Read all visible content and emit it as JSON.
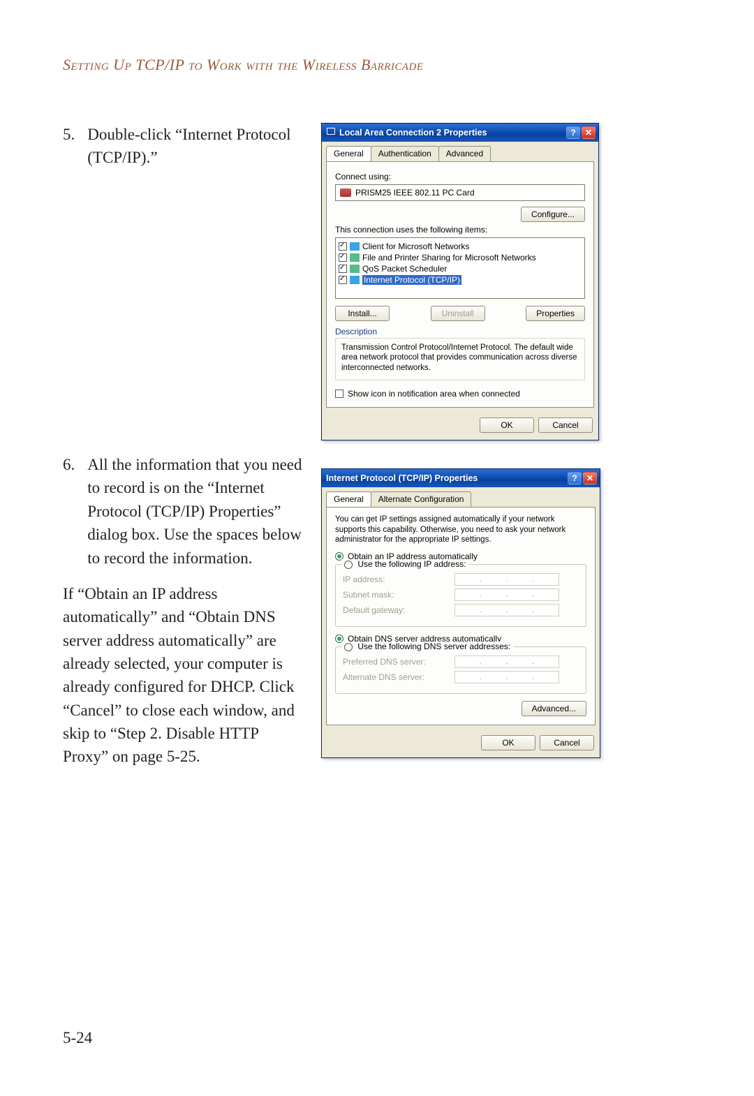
{
  "running_head": "Setting Up TCP/IP to Work with the Wireless Barricade",
  "page_number": "5-24",
  "steps": {
    "s5": {
      "num": "5.",
      "text": "Double-click “Internet Protocol (TCP/IP).”"
    },
    "s6": {
      "num": "6.",
      "text": "All the information that you need to record is on the “Internet Protocol (TCP/IP) Properties” dialog box. Use the spaces below to record the information."
    }
  },
  "followup": "If “Obtain an IP address automatically” and “Obtain DNS server address automatically” are already selected, your computer is already configured for DHCP. Click “Cancel” to close each window, and skip to “Step 2. Disable HTTP Proxy” on page 5-25.",
  "dlg1": {
    "title": "Local Area Connection 2 Properties",
    "help": "?",
    "close": "✕",
    "tabs": {
      "general": "General",
      "auth": "Authentication",
      "adv": "Advanced"
    },
    "connect_using_label": "Connect using:",
    "adapter": "PRISM25 IEEE 802.11 PC Card",
    "configure_btn": "Configure...",
    "items_label": "This connection uses the following items:",
    "items": [
      "Client for Microsoft Networks",
      "File and Printer Sharing for Microsoft Networks",
      "QoS Packet Scheduler",
      "Internet Protocol (TCP/IP)"
    ],
    "install_btn": "Install...",
    "uninstall_btn": "Uninstall",
    "properties_btn": "Properties",
    "description_label": "Description",
    "description_text": "Transmission Control Protocol/Internet Protocol. The default wide area network protocol that provides communication across diverse interconnected networks.",
    "show_icon_label": "Show icon in notification area when connected",
    "ok": "OK",
    "cancel": "Cancel"
  },
  "dlg2": {
    "title": "Internet Protocol (TCP/IP) Properties",
    "help": "?",
    "close": "✕",
    "tabs": {
      "general": "General",
      "alt": "Alternate Configuration"
    },
    "intro": "You can get IP settings assigned automatically if your network supports this capability. Otherwise, you need to ask your network administrator for the appropriate IP settings.",
    "obtain_ip": "Obtain an IP address automatically",
    "use_ip": "Use the following IP address:",
    "ip_label": "IP address:",
    "subnet_label": "Subnet mask:",
    "gateway_label": "Default gateway:",
    "obtain_dns": "Obtain DNS server address automatically",
    "use_dns": "Use the following DNS server addresses:",
    "pref_dns_label": "Preferred DNS server:",
    "alt_dns_label": "Alternate DNS server:",
    "advanced_btn": "Advanced...",
    "ok": "OK",
    "cancel": "Cancel"
  }
}
